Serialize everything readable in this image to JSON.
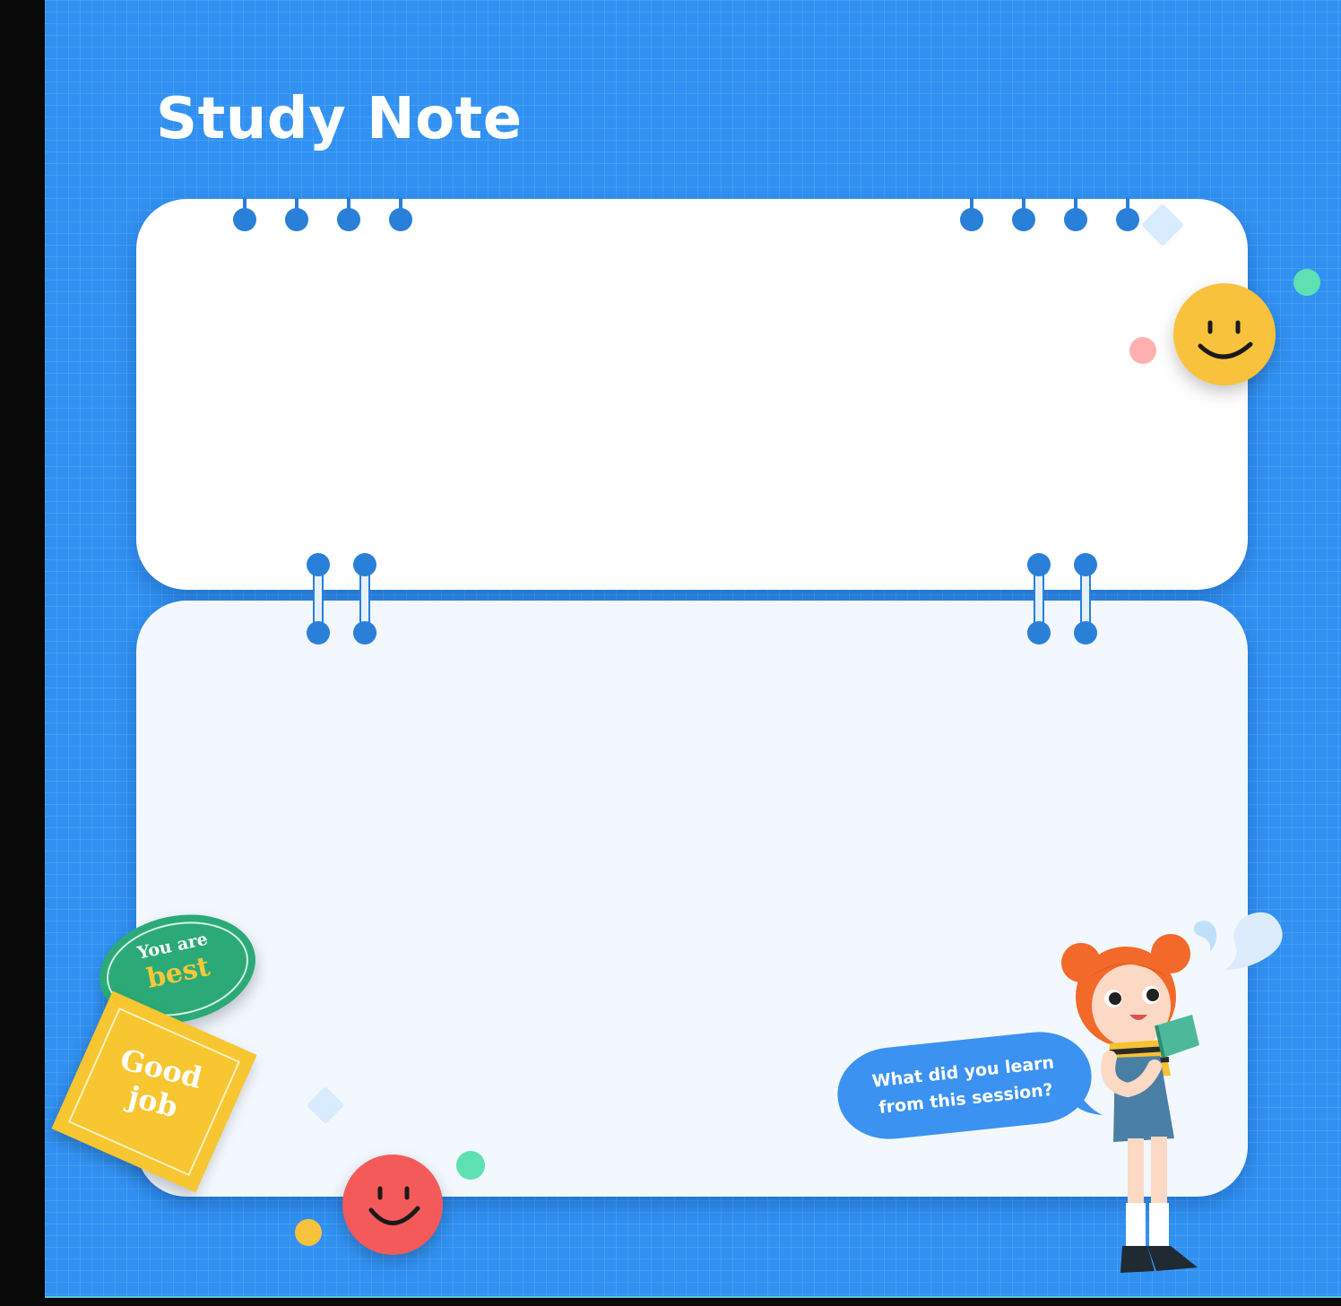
{
  "title": "Study Note",
  "speech_bubble": {
    "line1": "What did you learn",
    "line2": "from this session?"
  },
  "stickers": {
    "green": {
      "line1": "You are",
      "line2": "best"
    },
    "yellow": {
      "line1": "Good",
      "line2": "job"
    }
  },
  "colors": {
    "background": "#3091f2",
    "top_card": "#ffffff",
    "bottom_card": "#f2f8fe",
    "binder": "#2a7fd9",
    "smiley_yellow": "#f9c23c",
    "smiley_red": "#f55a5a",
    "sticker_green": "#2baa78",
    "sticker_yellow": "#f7c631"
  },
  "icons": [
    "smiley-face-icon",
    "speech-bubble-icon",
    "girl-character-illustration"
  ]
}
